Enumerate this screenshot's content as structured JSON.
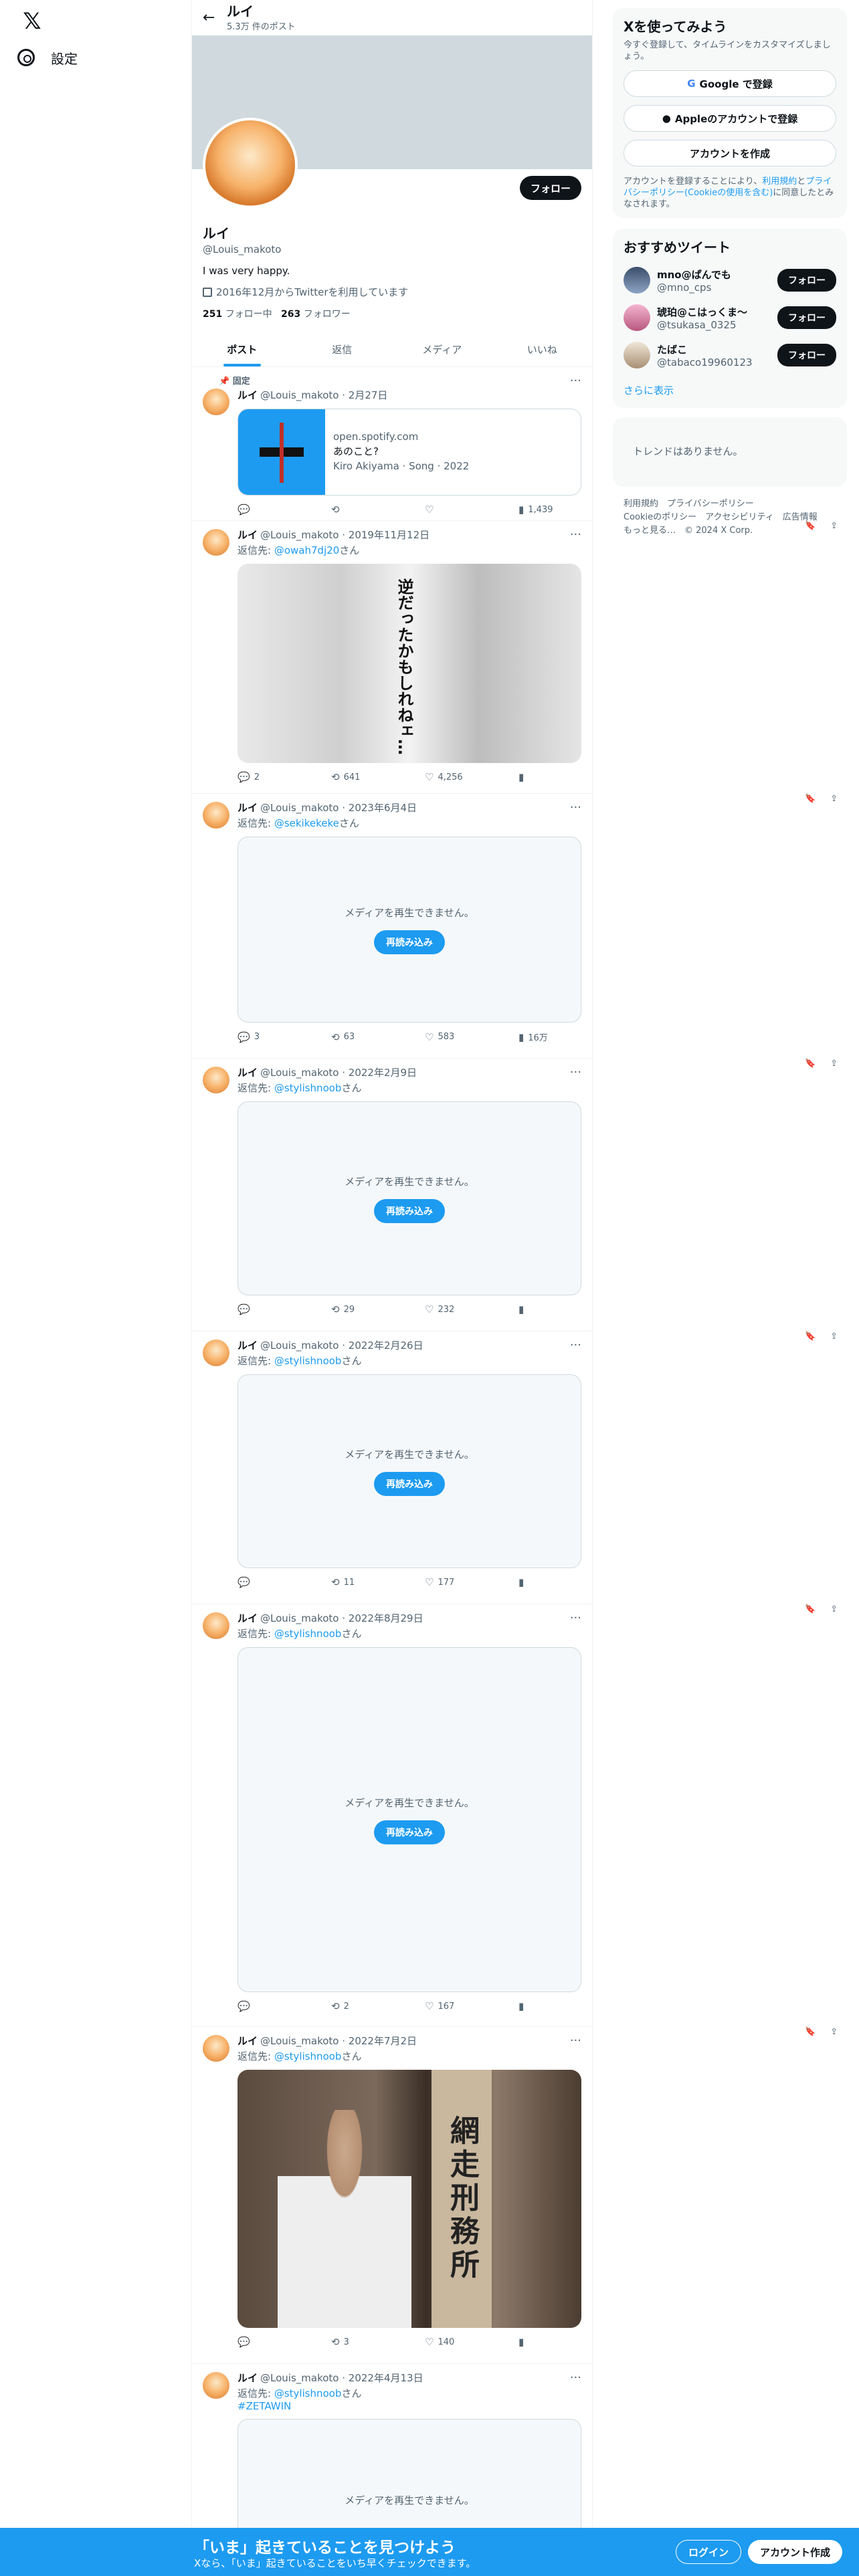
{
  "nav": {
    "logo": "𝕏",
    "settings": "設定"
  },
  "profile": {
    "title_name": "ルイ",
    "post_count": "5.3万 件のポスト",
    "name": "ルイ",
    "handle": "@Louis_makoto",
    "bio": "I was very happy.",
    "joined": "2016年12月からTwitterを利用しています",
    "following_count": "251",
    "following_label": "フォロー中",
    "followers_count": "263",
    "followers_label": "フォロワー",
    "follow_button": "フォロー"
  },
  "tabs": [
    "ポスト",
    "返信",
    "メディア",
    "いいね"
  ],
  "pinned_label": "固定",
  "tweets": [
    {
      "name": "ルイ",
      "handle": "@Louis_makoto",
      "date": "2月27日",
      "card_domain": "open.spotify.com",
      "card_title": "あのこと?",
      "card_desc": "Kiro Akiyama · Song · 2022",
      "reply": "",
      "retweet": "",
      "like": "",
      "views": "1,439"
    },
    {
      "name": "ルイ",
      "handle": "@Louis_makoto",
      "date": "2019年11月12日",
      "reply_prefix": "返信先: ",
      "reply_to": "@owah7dj20",
      "reply_suffix": "さん",
      "image_text": "逆だったかもしれねェ…",
      "reply": "2",
      "retweet": "641",
      "like": "4,256",
      "views": ""
    },
    {
      "name": "ルイ",
      "handle": "@Louis_makoto",
      "date": "2023年6月4日",
      "reply_prefix": "返信先: ",
      "reply_to": "@sekikekeke",
      "reply_suffix": "さん",
      "media_msg": "メディアを再生できません。",
      "reload": "再読み込み",
      "reply": "3",
      "retweet": "63",
      "like": "583",
      "views": "16万"
    },
    {
      "name": "ルイ",
      "handle": "@Louis_makoto",
      "date": "2022年2月9日",
      "reply_prefix": "返信先: ",
      "reply_to": "@stylishnoob",
      "reply_suffix": "さん",
      "media_msg": "メディアを再生できません。",
      "reload": "再読み込み",
      "reply": "",
      "retweet": "29",
      "like": "232",
      "views": ""
    },
    {
      "name": "ルイ",
      "handle": "@Louis_makoto",
      "date": "2022年2月26日",
      "reply_prefix": "返信先: ",
      "reply_to": "@stylishnoob",
      "reply_suffix": "さん",
      "media_msg": "メディアを再生できません。",
      "reload": "再読み込み",
      "reply": "",
      "retweet": "11",
      "like": "177",
      "views": ""
    },
    {
      "name": "ルイ",
      "handle": "@Louis_makoto",
      "date": "2022年8月29日",
      "reply_prefix": "返信先: ",
      "reply_to": "@stylishnoob",
      "reply_suffix": "さん",
      "media_msg": "メディアを再生できません。",
      "reload": "再読み込み",
      "reply": "",
      "retweet": "2",
      "like": "167",
      "views": ""
    },
    {
      "name": "ルイ",
      "handle": "@Louis_makoto",
      "date": "2022年7月2日",
      "reply_prefix": "返信先: ",
      "reply_to": "@stylishnoob",
      "reply_suffix": "さん",
      "image_text": "網走刑務所",
      "reply": "",
      "retweet": "3",
      "like": "140",
      "views": ""
    },
    {
      "name": "ルイ",
      "handle": "@Louis_makoto",
      "date": "2022年4月13日",
      "reply_prefix": "返信先: ",
      "reply_to": "@stylishnoob",
      "reply_suffix": "さん",
      "hashtag": "#ZETAWIN",
      "media_msg": "メディアを再生できません。"
    }
  ],
  "sidebar": {
    "signup_title": "Xを使ってみよう",
    "signup_sub": "今すぐ登録して、タイムラインをカスタマイズしましょう。",
    "google_btn": "Google で登録",
    "apple_btn": "Appleのアカウントで登録",
    "create_btn": "アカウントを作成",
    "terms_prefix": "アカウントを登録することにより、",
    "terms_link1": "利用規約",
    "terms_mid1": "と",
    "terms_link2": "プライバシーポリシー",
    "terms_link3": "(Cookieの使用を含む)",
    "terms_suffix": "に同意したとみなされます。",
    "rec_title": "おすすめツイート",
    "recs": [
      {
        "name": "mno@ぱんでも",
        "handle": "@mno_cps",
        "follow": "フォロー"
      },
      {
        "name": "琥珀@こはっくま〜",
        "handle": "@tsukasa_0325",
        "follow": "フォロー"
      },
      {
        "name": "たばこ",
        "handle": "@tabaco19960123",
        "follow": "フォロー"
      }
    ],
    "show_more": "さらに表示",
    "trend_empty": "トレンドはありません。",
    "footer1": "利用規約　プライバシーポリシー",
    "footer2": "Cookieのポリシー　アクセシビリティ　広告情報",
    "footer3": "もっと見る…　© 2024 X Corp."
  },
  "bottom_bar": {
    "title": "「いま」起きていることを見つけよう",
    "subtitle": "Xなら、「いま」起きていることをいち早くチェックできます。",
    "login": "ログイン",
    "signup": "アカウント作成"
  }
}
